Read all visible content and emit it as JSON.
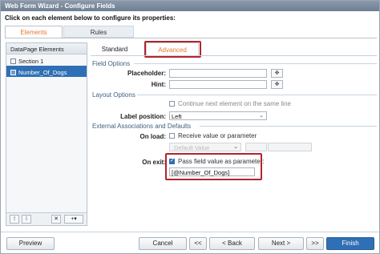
{
  "window": {
    "title": "Web Form Wizard - Configure Fields"
  },
  "instructions": "Click on each element below to configure its properties:",
  "top_tabs": [
    {
      "label": "Elements",
      "active": true
    },
    {
      "label": "Rules",
      "active": false
    }
  ],
  "left_panel": {
    "header": "DataPage Elements",
    "items": [
      {
        "label": "Section 1",
        "selected": false
      },
      {
        "label": "Number_Of_Dogs",
        "selected": true
      }
    ],
    "toolbar": {
      "up": "⇧",
      "down": "⇩",
      "delete": "✕",
      "add": "+▾"
    }
  },
  "sub_tabs": [
    {
      "label": "Standard",
      "active": false
    },
    {
      "label": "Advanced",
      "active": true
    }
  ],
  "field_options": {
    "section_label": "Field Options",
    "placeholder_label": "Placeholder:",
    "placeholder_value": "",
    "hint_label": "Hint:",
    "hint_value": ""
  },
  "layout_options": {
    "section_label": "Layout Options",
    "continue_label": "Continue next element on the same line",
    "continue_checked": false,
    "label_position_label": "Label position:",
    "label_position_value": "Left"
  },
  "external": {
    "section_label": "External Associations and Defaults",
    "on_load_label": "On load:",
    "receive_label": "Receive value or parameter",
    "receive_checked": false,
    "default_value_select": "Default Value",
    "on_exit_label": "On exit:",
    "pass_label": "Pass field value as parameter:",
    "pass_checked": true,
    "pass_value": "[@Number_Of_Dogs]"
  },
  "footer": {
    "preview": "Preview",
    "cancel": "Cancel",
    "first": "<<",
    "back": "< Back",
    "next": "Next >",
    "last": ">>",
    "finish": "Finish"
  },
  "colors": {
    "accent": "#e8772e",
    "selection": "#2f6fb5",
    "highlight_box": "#b3242c"
  }
}
